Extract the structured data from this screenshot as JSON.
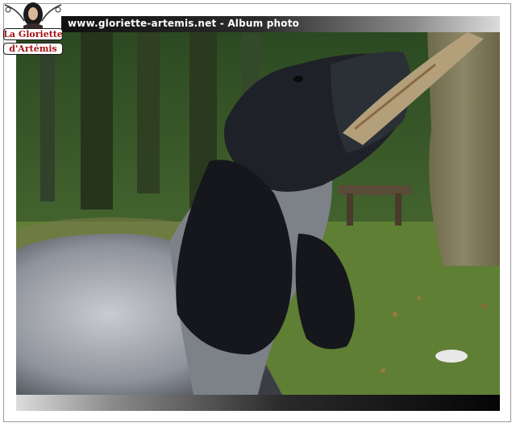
{
  "window": {
    "title": "www.gloriette-artemis.net - Album photo"
  },
  "logo": {
    "line1": "La Gloriette",
    "line2": "d'Artémis",
    "icon": "woman-portrait-emblem"
  },
  "photo": {
    "icon": "dog-photo"
  },
  "colors": {
    "title_text": "#ffffff",
    "logo_text": "#a31414",
    "bar_dark": "#111111",
    "bar_light": "#dcdcdc"
  }
}
